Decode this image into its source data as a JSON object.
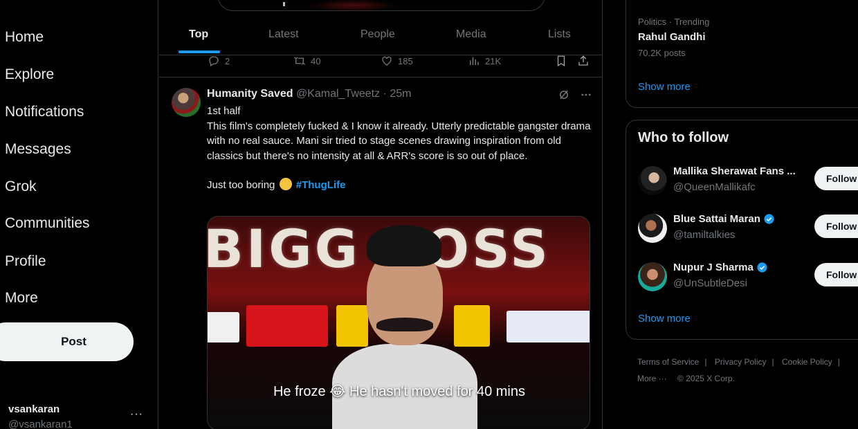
{
  "nav": {
    "items": [
      "Home",
      "Explore",
      "Notifications",
      "Messages",
      "Grok",
      "Communities",
      "Profile",
      "More"
    ],
    "post_label": "Post"
  },
  "account": {
    "name": "vsankaran",
    "handle": "@vsankaran1",
    "more": "···"
  },
  "tabs": [
    {
      "label": "Top",
      "active": true
    },
    {
      "label": "Latest",
      "active": false
    },
    {
      "label": "People",
      "active": false
    },
    {
      "label": "Media",
      "active": false
    },
    {
      "label": "Lists",
      "active": false
    }
  ],
  "previous_tweet_actions": {
    "replies": "2",
    "reposts": "40",
    "likes": "185",
    "views": "21K"
  },
  "tweet": {
    "name": "Humanity Saved",
    "handle": "@Kamal_Tweetz",
    "dot": "·",
    "time": "25m",
    "lines": [
      "1st half",
      "This film's completely fucked & I know it already. Utterly predictable gangster drama with no real sauce. Mani sir tried to stage scenes drawing inspiration from old classics but there's no intensity at all & ARR's score is so out of place."
    ],
    "closing_text": "Just too boring",
    "hashtag": "#ThugLife",
    "media": {
      "title_text": "BIGG BOSS",
      "caption": "He froze 😂 He hasn't moved for 40 mins"
    }
  },
  "trending": {
    "category": "Politics · Trending",
    "name": "Rahul Gandhi",
    "posts": "70.2K posts",
    "show_more": "Show more"
  },
  "who_to_follow": {
    "title": "Who to follow",
    "users": [
      {
        "name": "Mallika Sherawat Fans ...",
        "handle": "@QueenMallikafc",
        "verified": false,
        "button": "Follow"
      },
      {
        "name": "Blue Sattai Maran",
        "handle": "@tamiltalkies",
        "verified": true,
        "button": "Follow"
      },
      {
        "name": "Nupur J Sharma",
        "handle": "@UnSubtleDesi",
        "verified": true,
        "button": "Follow"
      }
    ],
    "show_more": "Show more"
  },
  "footer": {
    "links": [
      "Terms of Service",
      "Privacy Policy",
      "Cookie Policy"
    ],
    "more": "More ···",
    "copyright": "© 2025 X Corp."
  },
  "colors": {
    "accent": "#1d9bf0",
    "background": "#000000",
    "border": "#2f3336",
    "muted": "#71767b"
  }
}
